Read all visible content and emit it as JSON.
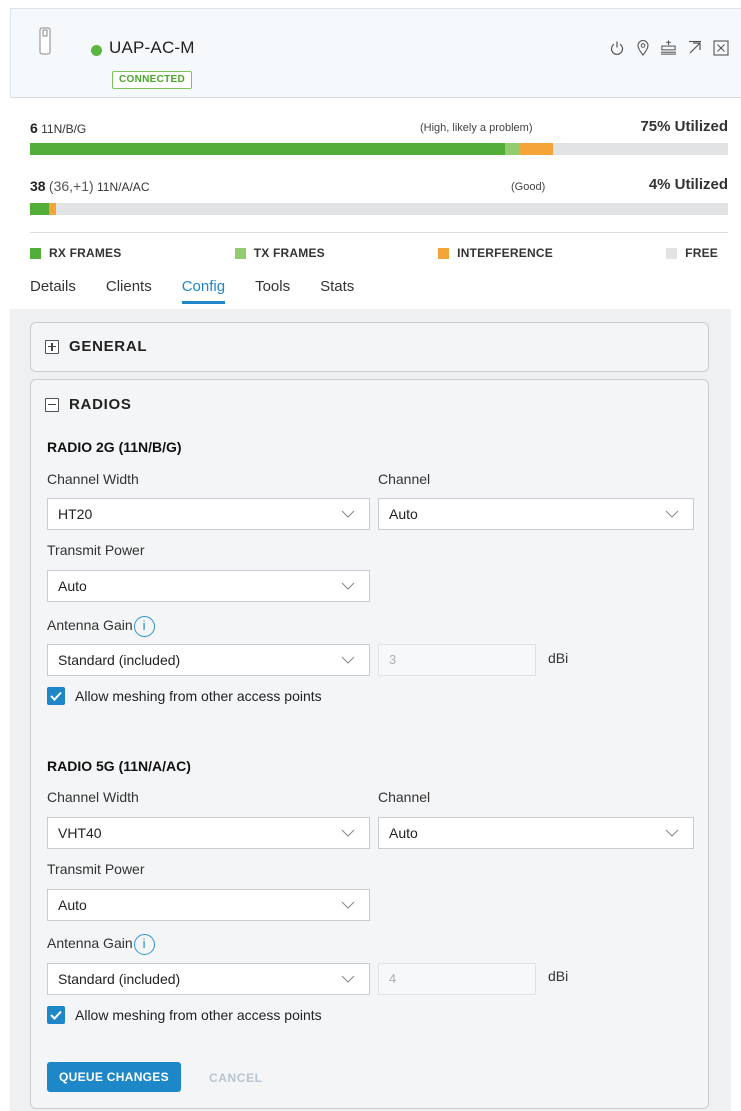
{
  "device": {
    "name": "UAP-AC-M",
    "state": "CONNECTED",
    "state_color": "#5bb73f",
    "header_icons": [
      "power-icon",
      "locate-icon",
      "devices-icon",
      "popout-icon",
      "close-icon"
    ]
  },
  "radios_usage": [
    {
      "channel": "6",
      "channel_extra": "",
      "band": "11N/B/G",
      "status": "(High, likely a problem)",
      "utilization": "75% Utilized",
      "segments": {
        "rx": 0.68,
        "tx": 0.02,
        "interference": 0.05,
        "free": 0.25
      }
    },
    {
      "channel": "38",
      "channel_extra": "(36,+1)",
      "band": "11N/A/AC",
      "status": "(Good)",
      "utilization": "4% Utilized",
      "segments": {
        "rx": 0.027,
        "tx": 0.0,
        "interference": 0.01,
        "free": 0.963
      }
    }
  ],
  "legend": [
    {
      "label": "RX FRAMES",
      "color": "#52ad39"
    },
    {
      "label": "TX FRAMES",
      "color": "#93cc6e"
    },
    {
      "label": "INTERFERENCE",
      "color": "#f5a437"
    },
    {
      "label": "FREE",
      "color": "#e2e3e5"
    }
  ],
  "tabs": [
    {
      "label": "Details",
      "active": false
    },
    {
      "label": "Clients",
      "active": false
    },
    {
      "label": "Config",
      "active": true
    },
    {
      "label": "Tools",
      "active": false
    },
    {
      "label": "Stats",
      "active": false
    }
  ],
  "panels": {
    "general": {
      "title": "GENERAL"
    },
    "radios": {
      "title": "RADIOS"
    }
  },
  "radio2g": {
    "title": "RADIO 2G (11N/B/G)",
    "channel_width_label": "Channel Width",
    "channel_width": "HT20",
    "channel_label": "Channel",
    "channel": "Auto",
    "tx_power_label": "Transmit Power",
    "tx_power": "Auto",
    "antenna_gain_label": "Antenna Gain",
    "antenna_gain": "Standard (included)",
    "gain_value": "3",
    "gain_unit": "dBi",
    "mesh_label": "Allow meshing from other access points",
    "mesh_checked": true
  },
  "radio5g": {
    "title": "RADIO 5G (11N/A/AC)",
    "channel_width_label": "Channel Width",
    "channel_width": "VHT40",
    "channel_label": "Channel",
    "channel": "Auto",
    "tx_power_label": "Transmit Power",
    "tx_power": "Auto",
    "antenna_gain_label": "Antenna Gain",
    "antenna_gain": "Standard (included)",
    "gain_value": "4",
    "gain_unit": "dBi",
    "mesh_label": "Allow meshing from other access points",
    "mesh_checked": true
  },
  "info_glyph": "i",
  "actions": {
    "queue_label": "QUEUE CHANGES",
    "cancel_label": "CANCEL"
  }
}
